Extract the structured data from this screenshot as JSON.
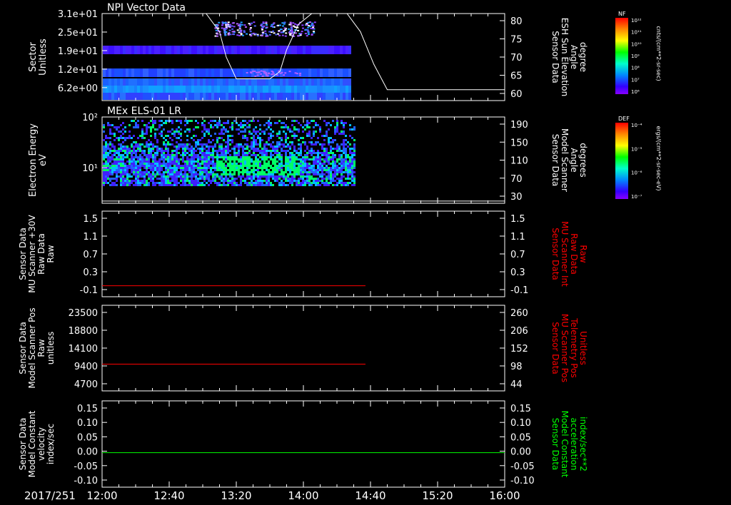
{
  "date_label": "2017/251",
  "x_ticks": [
    "12:00",
    "12:40",
    "13:20",
    "14:00",
    "14:40",
    "15:20",
    "16:00"
  ],
  "colors": {
    "background": "#000000",
    "axis": "#ffffff",
    "red": "#ff0000",
    "green": "#00ff00"
  },
  "panels": [
    {
      "id": "npi",
      "title": "NPI Vector Data",
      "left_label": [
        "Sector",
        "Unitless"
      ],
      "left_color": "#ffffff",
      "left_ticks": [
        "3.1e+01",
        "2.5e+01",
        "1.9e+01",
        "1.2e+01",
        "6.2e+00"
      ],
      "right_label": [
        "Sensor Data",
        "ESH Sun Elevation",
        "Angle",
        "degree"
      ],
      "right_color": "#ffffff",
      "right_ticks": [
        "80",
        "75",
        "70",
        "65",
        "60"
      ],
      "colorbar": {
        "label": "NF",
        "units": "cnts/(cm**2-sr-sec)",
        "ticks": [
          "10¹²",
          "10¹¹",
          "10¹⁰",
          "10⁹",
          "10⁸",
          "10⁷",
          "10⁶"
        ]
      }
    },
    {
      "id": "els",
      "title": "MEx ELS-01 LR",
      "left_label": [
        "Electron Energy",
        "eV"
      ],
      "left_color": "#ffffff",
      "left_ticks": [
        "10²",
        "10¹"
      ],
      "right_label": [
        "Sensor Data",
        "Model Scanner",
        "Angle",
        "degrees"
      ],
      "right_color": "#ffffff",
      "right_ticks": [
        "190",
        "150",
        "110",
        "70",
        "30"
      ],
      "colorbar": {
        "label": "DEF",
        "units": "ergs/(cm**2-sr-sec-eV)",
        "ticks": [
          "10⁻⁴",
          "10⁻⁵",
          "10⁻⁶",
          "10⁻⁷"
        ]
      }
    },
    {
      "id": "mu30",
      "title": "",
      "left_label": [
        "Sensor Data",
        "MU Scanner +30V",
        "Raw Data",
        "Raw"
      ],
      "left_color": "#ffffff",
      "left_ticks": [
        "1.5",
        "1.1",
        "0.7",
        "0.3",
        "-0.1"
      ],
      "right_label": [
        "Sensor Data",
        "MU Scanner Int",
        "Raw Data",
        "Raw"
      ],
      "right_color": "#ff0000",
      "right_ticks": [
        "1.5",
        "1.1",
        "0.7",
        "0.3",
        "-0.1"
      ]
    },
    {
      "id": "mupos",
      "title": "",
      "left_label": [
        "Sensor Data",
        "Model Scanner Pos",
        "Raw",
        "unitless"
      ],
      "left_color": "#ffffff",
      "left_ticks": [
        "23500",
        "18800",
        "14100",
        "9400",
        "4700"
      ],
      "right_label": [
        "Sensor Data",
        "MU Scanner Pos",
        "Telemetry Pos",
        "Unitless"
      ],
      "right_color": "#ff0000",
      "right_ticks": [
        "260",
        "206",
        "152",
        "98",
        "44"
      ]
    },
    {
      "id": "const",
      "title": "",
      "left_label": [
        "Sensor Data",
        "Model Constant",
        "velocity",
        "index/sec"
      ],
      "left_color": "#ffffff",
      "left_ticks": [
        "0.15",
        "0.10",
        "0.05",
        "0.00",
        "-0.05",
        "-0.10"
      ],
      "right_label": [
        "Sensor Data",
        "Model Constant",
        "acceleration",
        "index/sec**2"
      ],
      "right_color": "#00ff00",
      "right_ticks": [
        "0.15",
        "0.10",
        "0.05",
        "0.00",
        "-0.05",
        "-0.10"
      ]
    }
  ],
  "chart_data": [
    {
      "type": "heatmap",
      "title": "NPI Vector Data",
      "x_range": [
        "12:00",
        "16:00"
      ],
      "data_extent_x": [
        "12:00",
        "14:27"
      ],
      "ylabel": "Sector Unitless",
      "ylim": [
        0,
        31
      ],
      "line_series": {
        "name": "Sensor Data ESH Sun Elevation Angle",
        "units": "degree",
        "ylim": [
          56,
          80
        ],
        "x": [
          "12:00",
          "13:02",
          "13:10",
          "13:14",
          "13:20",
          "13:30",
          "13:40",
          "13:46",
          "13:50",
          "13:57",
          "14:05",
          "14:20",
          "14:26",
          "14:34",
          "14:42",
          "14:50",
          "15:00",
          "16:00"
        ],
        "y": [
          80,
          80,
          75,
          68,
          62,
          62,
          62,
          64,
          70,
          77,
          80,
          80,
          80,
          75,
          66,
          59,
          59,
          59
        ]
      }
    },
    {
      "type": "heatmap",
      "title": "MEx ELS-01 LR",
      "x_range": [
        "12:00",
        "16:00"
      ],
      "data_extent_x": [
        "12:00",
        "14:30"
      ],
      "ylabel": "Electron Energy eV",
      "ylog": true,
      "line_series": {
        "name": "Sensor Data Model Scanner Angle",
        "units": "degrees",
        "ylim": [
          0,
          190
        ],
        "x": [
          "12:00",
          "16:00"
        ],
        "y": [
          5,
          5
        ]
      }
    },
    {
      "type": "line",
      "series": [
        {
          "name": "Sensor Data MU Scanner Int Raw Data",
          "x": [
            "12:00",
            "14:37"
          ],
          "y": [
            -0.07,
            -0.07
          ]
        }
      ],
      "ylim": [
        -0.3,
        1.5
      ]
    },
    {
      "type": "line",
      "series": [
        {
          "name": "Sensor Data MU Scanner Pos Telemetry Pos",
          "x": [
            "12:00",
            "14:37"
          ],
          "y": [
            88,
            88
          ]
        }
      ],
      "ylim": [
        10,
        260
      ]
    },
    {
      "type": "line",
      "series": [
        {
          "name": "Sensor Data Model Constant acceleration",
          "x": [
            "12:00",
            "16:00"
          ],
          "y": [
            0.0,
            0.0
          ]
        }
      ],
      "ylim": [
        -0.1,
        0.15
      ]
    }
  ]
}
